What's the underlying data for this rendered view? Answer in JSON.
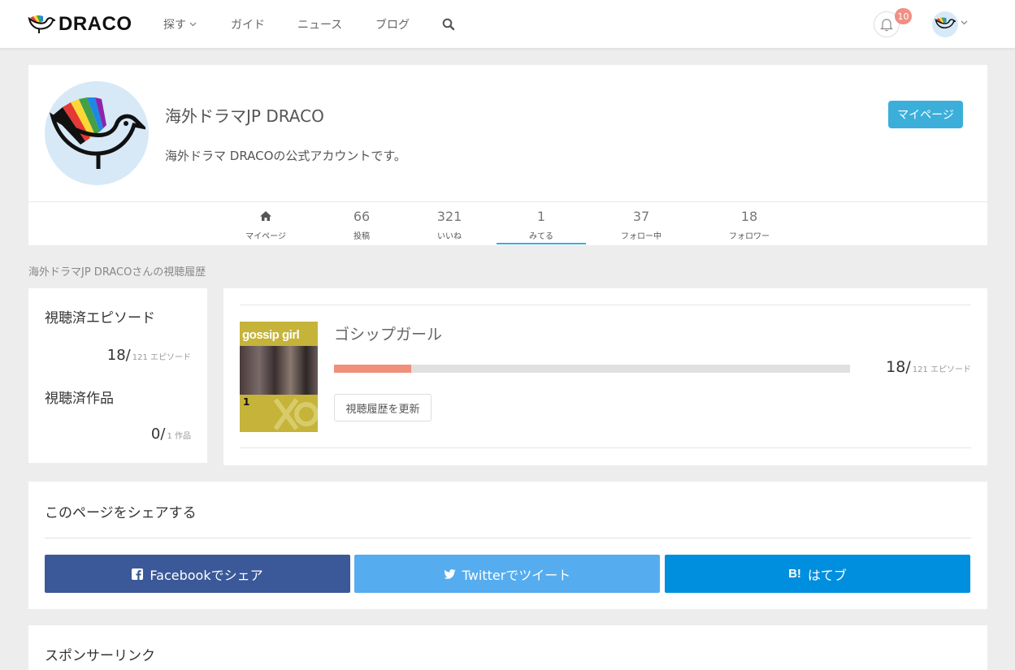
{
  "header": {
    "logo_text": "DRACO",
    "nav": [
      {
        "label": "探す"
      },
      {
        "label": "ガイド"
      },
      {
        "label": "ニュース"
      },
      {
        "label": "ブログ"
      }
    ],
    "notification_count": "10"
  },
  "profile": {
    "name": "海外ドラマJP DRACO",
    "description": "海外ドラマ DRACOの公式アカウントです。",
    "mypage_button": "マイページ",
    "stats": [
      {
        "value": "",
        "label": "マイページ"
      },
      {
        "value": "66",
        "label": "投稿"
      },
      {
        "value": "321",
        "label": "いいね"
      },
      {
        "value": "1",
        "label": "みてる"
      },
      {
        "value": "37",
        "label": "フォロー中"
      },
      {
        "value": "18",
        "label": "フォロワー"
      }
    ],
    "active_tab": "みてる"
  },
  "history_caption": "海外ドラマJP DRACOさんの視聴履歴",
  "summary": {
    "episodes_title": "視聴済エピソード",
    "episodes_value": "18/",
    "episodes_total": "121 エピソード",
    "works_title": "視聴済作品",
    "works_value": "0/",
    "works_total": "1 作品"
  },
  "watching": {
    "title": "ゴシップガール",
    "poster_text": "gossip girl",
    "poster_season": "1",
    "progress": 0.149,
    "count": "18/",
    "count_total": "121 エピソード",
    "update_button": "視聴履歴を更新"
  },
  "share": {
    "title": "このページをシェアする",
    "facebook": "Facebookでシェア",
    "twitter": "Twitterでツイート",
    "hatena_icon": "B!",
    "hatena": "はてブ",
    "colors": {
      "facebook": "#3b5998",
      "twitter": "#55acee",
      "hatena": "#008fde"
    }
  },
  "sponsor": {
    "title": "スポンサーリンク"
  }
}
